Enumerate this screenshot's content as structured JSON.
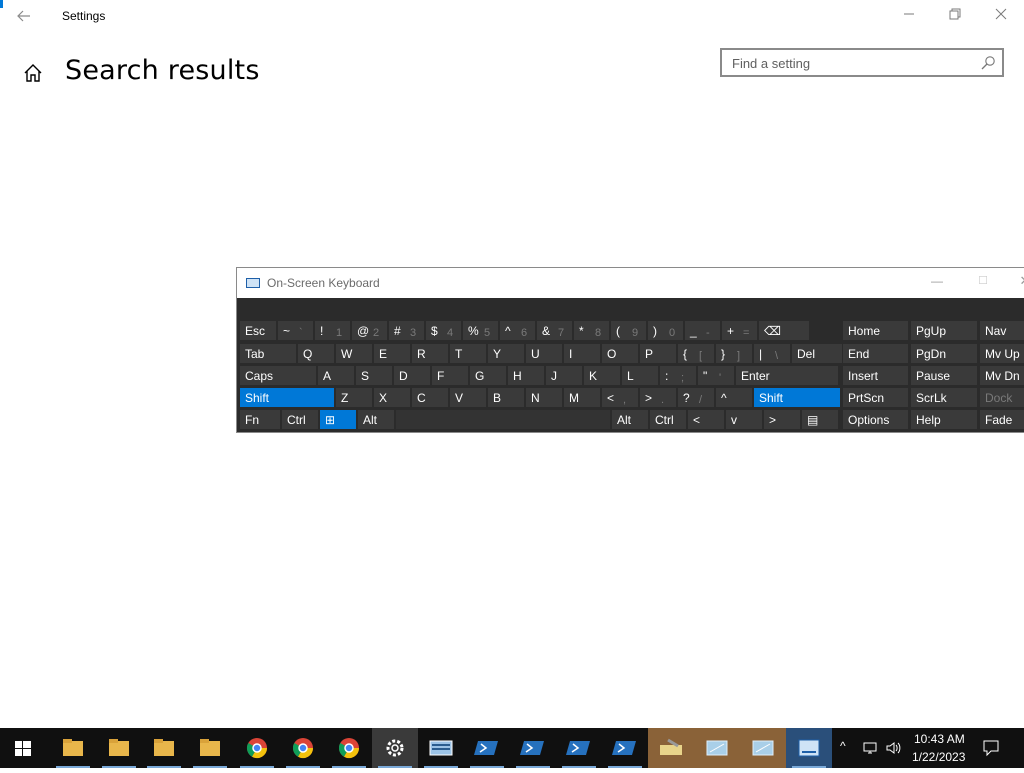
{
  "window": {
    "title": "Settings",
    "back_icon": "back-arrow-icon",
    "minimize_icon": "minimize-icon",
    "restore_icon": "restore-icon",
    "close_icon": "close-icon"
  },
  "page": {
    "title": "Search results"
  },
  "search": {
    "placeholder": "Find a setting",
    "icon": "search-icon"
  },
  "osk": {
    "title": "On-Screen Keyboard",
    "rows": [
      [
        {
          "p": "Esc"
        },
        {
          "p": "~",
          "s": "`"
        },
        {
          "p": "!",
          "s": "1"
        },
        {
          "p": "@",
          "s": "2"
        },
        {
          "p": "#",
          "s": "3"
        },
        {
          "p": "$",
          "s": "4"
        },
        {
          "p": "%",
          "s": "5"
        },
        {
          "p": "^",
          "s": "6"
        },
        {
          "p": "&",
          "s": "7"
        },
        {
          "p": "*",
          "s": "8"
        },
        {
          "p": "(",
          "s": "9"
        },
        {
          "p": ")",
          "s": "0"
        },
        {
          "p": "_",
          "s": "-"
        },
        {
          "p": "+",
          "s": "="
        },
        {
          "p": "⌫"
        }
      ],
      [
        {
          "p": "Tab"
        },
        {
          "p": "Q"
        },
        {
          "p": "W"
        },
        {
          "p": "E"
        },
        {
          "p": "R"
        },
        {
          "p": "T"
        },
        {
          "p": "Y"
        },
        {
          "p": "U"
        },
        {
          "p": "I"
        },
        {
          "p": "O"
        },
        {
          "p": "P"
        },
        {
          "p": "{",
          "s": "["
        },
        {
          "p": "}",
          "s": "]"
        },
        {
          "p": "|",
          "s": "\\"
        },
        {
          "p": "Del"
        }
      ],
      [
        {
          "p": "Caps"
        },
        {
          "p": "A"
        },
        {
          "p": "S"
        },
        {
          "p": "D"
        },
        {
          "p": "F"
        },
        {
          "p": "G"
        },
        {
          "p": "H"
        },
        {
          "p": "J"
        },
        {
          "p": "K"
        },
        {
          "p": "L"
        },
        {
          "p": ":",
          "s": ";"
        },
        {
          "p": "\"",
          "s": "'"
        },
        {
          "p": "Enter"
        }
      ],
      [
        {
          "p": "Shift"
        },
        {
          "p": "Z"
        },
        {
          "p": "X"
        },
        {
          "p": "C"
        },
        {
          "p": "V"
        },
        {
          "p": "B"
        },
        {
          "p": "N"
        },
        {
          "p": "M"
        },
        {
          "p": "<",
          "s": ","
        },
        {
          "p": ">",
          "s": "."
        },
        {
          "p": "?",
          "s": "/"
        },
        {
          "p": "^"
        },
        {
          "p": "Shift"
        }
      ],
      [
        {
          "p": "Fn"
        },
        {
          "p": "Ctrl"
        },
        {
          "p": "⊞"
        },
        {
          "p": "Alt"
        },
        {
          "p": ""
        },
        {
          "p": "Alt"
        },
        {
          "p": "Ctrl"
        },
        {
          "p": "<"
        },
        {
          "p": "v"
        },
        {
          "p": ">"
        },
        {
          "p": "▤"
        }
      ]
    ],
    "nav": [
      [
        "Home",
        "PgUp",
        "Nav"
      ],
      [
        "End",
        "PgDn",
        "Mv Up"
      ],
      [
        "Insert",
        "Pause",
        "Mv Dn"
      ],
      [
        "PrtScn",
        "ScrLk",
        "Dock"
      ],
      [
        "Options",
        "Help",
        "Fade"
      ]
    ]
  },
  "taskbar": {
    "start_icon": "windows-start-icon",
    "apps": [
      "file-explorer-icon",
      "file-explorer-icon",
      "file-explorer-icon",
      "file-explorer-icon",
      "chrome-icon",
      "chrome-icon",
      "chrome-icon",
      "settings-gear-icon",
      "keyboard-app-icon",
      "powershell-icon",
      "powershell-icon",
      "powershell-icon",
      "powershell-icon",
      "tool-icon",
      "remote-desktop-icon",
      "remote-desktop-icon",
      "on-screen-keyboard-icon"
    ],
    "tray": {
      "chevron": "^",
      "network_icon": "network-icon",
      "volume_icon": "volume-icon",
      "notification_icon": "notification-icon"
    },
    "time": "10:43 AM",
    "date": "1/22/2023"
  },
  "colors": {
    "accent": "#0078d7",
    "osk_bg": "#2b2b2b",
    "key_bg": "#3a3a3a",
    "taskbar_bg": "#101010"
  }
}
